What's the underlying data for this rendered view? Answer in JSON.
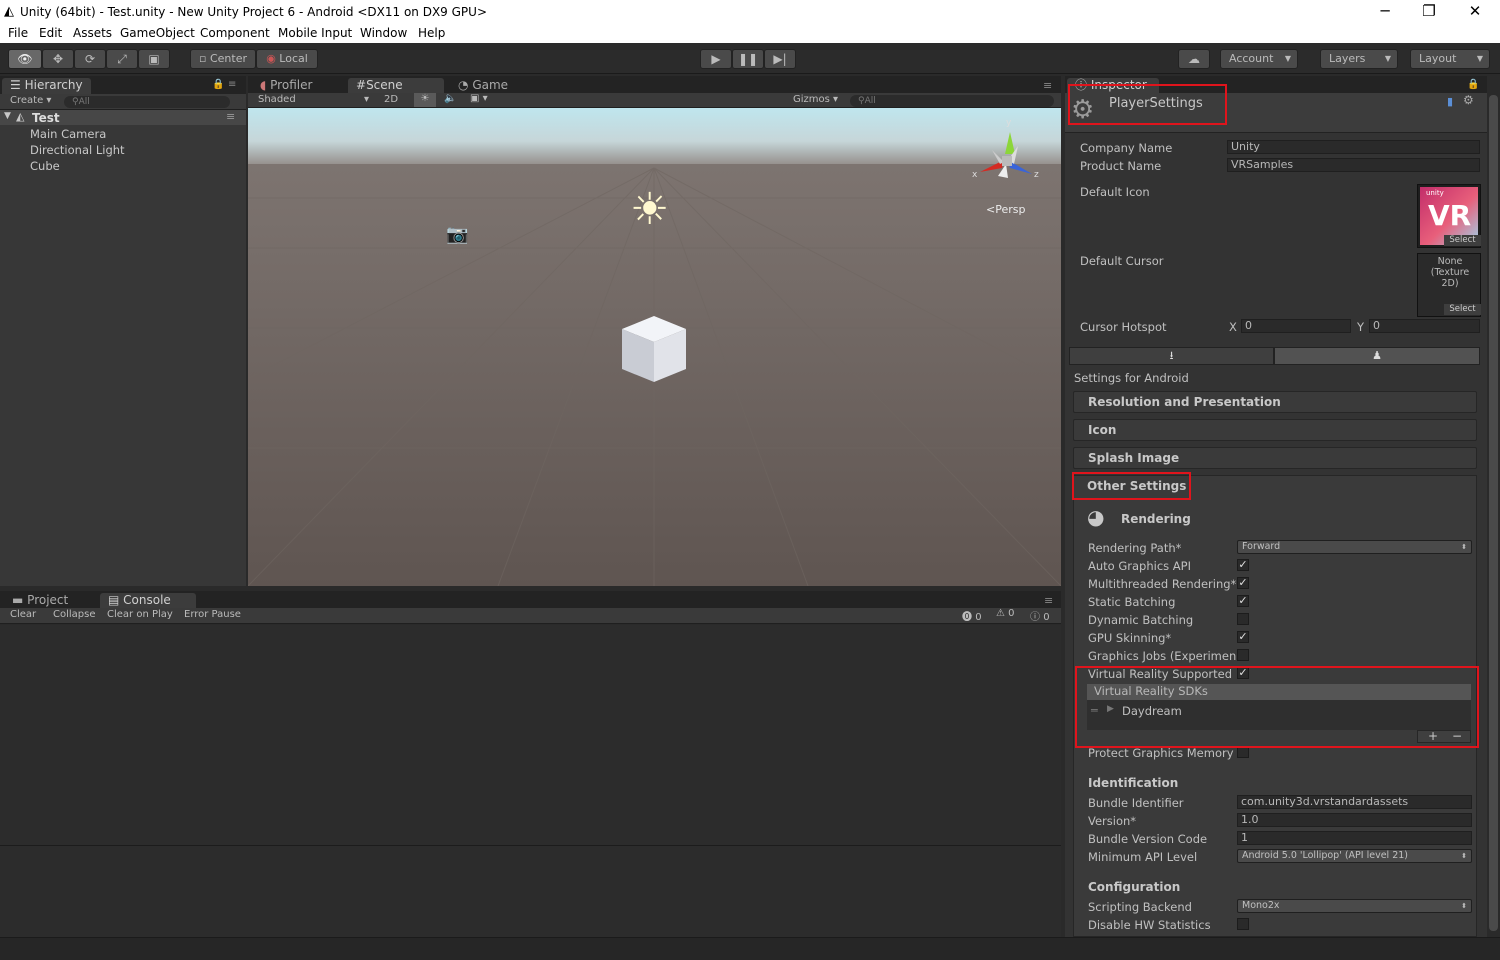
{
  "window": {
    "title": "Unity (64bit) - Test.unity - New Unity Project 6 - Android <DX11 on DX9 GPU>",
    "controls": {
      "minimize": "─",
      "restore": "❐",
      "close": "✕"
    }
  },
  "menu": [
    "File",
    "Edit",
    "Assets",
    "GameObject",
    "Component",
    "Mobile Input",
    "Window",
    "Help"
  ],
  "toolbar": {
    "pivot": "Center",
    "space": "Local",
    "account": "Account",
    "layers": "Layers",
    "layout": "Layout"
  },
  "hierarchy": {
    "tab": "Hierarchy",
    "create": "Create",
    "search": "All",
    "scene": "Test",
    "items": [
      "Main Camera",
      "Directional Light",
      "Cube"
    ]
  },
  "scene_panel": {
    "tabs": [
      "Profiler",
      "Scene",
      "Game"
    ],
    "shading": "Shaded",
    "mode_2d": "2D",
    "gizmos": "Gizmos",
    "search": "All",
    "gizmo_axes": {
      "x": "x",
      "y": "y",
      "z": "z"
    },
    "projection": "Persp"
  },
  "console_panel": {
    "tabs": [
      "Project",
      "Console"
    ],
    "buttons": [
      "Clear",
      "Collapse",
      "Clear on Play",
      "Error Pause"
    ],
    "counts": {
      "errors": "0",
      "warnings": "0",
      "messages": "0"
    }
  },
  "inspector": {
    "tab": "Inspector",
    "title": "PlayerSettings",
    "company_name_label": "Company Name",
    "company_name": "Unity",
    "product_name_label": "Product Name",
    "product_name": "VRSamples",
    "default_icon_label": "Default Icon",
    "icon_brand": "unity",
    "icon_letters": "VR",
    "select": "Select",
    "default_cursor_label": "Default Cursor",
    "cursor_none": "None (Texture 2D)",
    "cursor_hotspot_label": "Cursor Hotspot",
    "hotspot_x_label": "X",
    "hotspot_x": "0",
    "hotspot_y_label": "Y",
    "hotspot_y": "0",
    "settings_for": "Settings for Android",
    "sections": [
      "Resolution and Presentation",
      "Icon",
      "Splash Image",
      "Other Settings"
    ],
    "rendering": {
      "header": "Rendering",
      "rows": [
        {
          "label": "Rendering Path*",
          "type": "dropdown",
          "value": "Forward"
        },
        {
          "label": "Auto Graphics API",
          "type": "check",
          "checked": true
        },
        {
          "label": "Multithreaded Rendering*",
          "type": "check",
          "checked": true
        },
        {
          "label": "Static Batching",
          "type": "check",
          "checked": true
        },
        {
          "label": "Dynamic Batching",
          "type": "check",
          "checked": false
        },
        {
          "label": "GPU Skinning*",
          "type": "check",
          "checked": true
        },
        {
          "label": "Graphics Jobs (Experimen",
          "type": "check",
          "checked": false
        },
        {
          "label": "Virtual Reality Supported",
          "type": "check",
          "checked": true
        }
      ]
    },
    "vr_sdks": {
      "header": "Virtual Reality SDKs",
      "items": [
        "Daydream"
      ],
      "add": "+",
      "remove": "−"
    },
    "protect_graphics_memory": {
      "label": "Protect Graphics Memory",
      "checked": false
    },
    "identification": {
      "header": "Identification",
      "bundle_identifier_label": "Bundle Identifier",
      "bundle_identifier": "com.unity3d.vrstandardassets",
      "version_label": "Version*",
      "version": "1.0",
      "bundle_version_code_label": "Bundle Version Code",
      "bundle_version_code": "1",
      "min_api_label": "Minimum API Level",
      "min_api": "Android 5.0 'Lollipop' (API level 21)"
    },
    "configuration": {
      "header": "Configuration",
      "scripting_backend_label": "Scripting Backend",
      "scripting_backend": "Mono2x",
      "disable_hw_stats_label": "Disable HW Statistics",
      "disable_hw_stats": false
    }
  },
  "colors": {
    "highlight_red": "#e0141c",
    "sky_top": "#bfe6ee",
    "ground": "#665c57"
  }
}
